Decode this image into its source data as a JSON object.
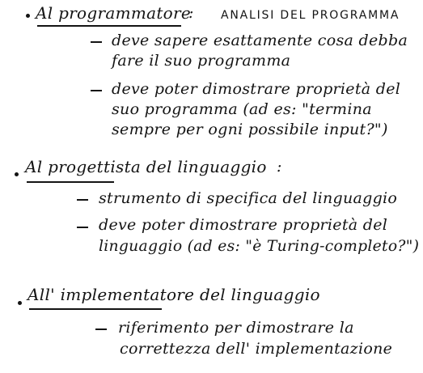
{
  "sections": [
    {
      "heading": "Al programmatore",
      "separator": ":",
      "subtitle": "ANALISI DEL PROGRAMMA",
      "items": [
        [
          "deve sapere esattamente cosa debba",
          "fare il suo programma"
        ],
        [
          "deve poter dimostrare proprietà del",
          "suo programma  (ad es: \"termina",
          "sempre per ogni possibile input?\")"
        ]
      ]
    },
    {
      "heading": "Al progettista del linguaggio",
      "separator": ":",
      "items": [
        [
          "strumento di specifica del linguaggio"
        ],
        [
          "deve poter dimostrare proprietà del",
          "linguaggio  (ad es: \"è Turing-completo?\")"
        ]
      ]
    },
    {
      "heading": "All' implementatore del linguaggio",
      "items": [
        [
          "riferimento per dimostrare la",
          "correttezza dell' implementazione"
        ]
      ]
    }
  ]
}
